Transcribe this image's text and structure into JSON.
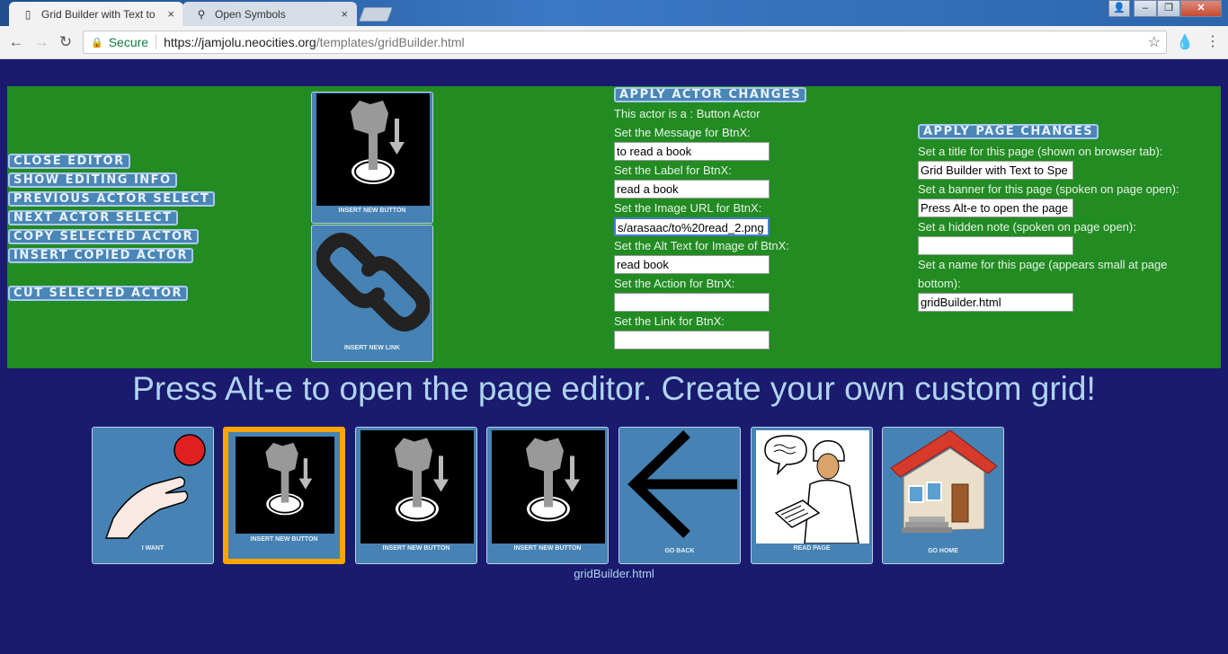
{
  "browser": {
    "tabs": [
      {
        "label": "Grid Builder with Text to",
        "close": "×"
      },
      {
        "label": "Open Symbols",
        "close": "×"
      }
    ],
    "window_controls": {
      "minimize": "–",
      "maximize": "❐",
      "close": "✕"
    },
    "security": "Secure",
    "url_host": "https://jamjolu.neocities.org",
    "url_path": "/templates/gridBuilder.html"
  },
  "editor": {
    "side_buttons": [
      "CLOSE EDITOR",
      "SHOW EDITING INFO",
      "PREVIOUS ACTOR SELECT",
      "NEXT ACTOR SELECT",
      "COPY SELECTED ACTOR",
      "INSERT COPIED ACTOR",
      "CUT SELECTED ACTOR"
    ],
    "insert_cards": [
      {
        "caption": "INSERT NEW BUTTON",
        "icon": "press-button-icon"
      },
      {
        "caption": "INSERT NEW LINK",
        "icon": "chain-link-icon"
      }
    ],
    "actor": {
      "apply_label": "APPLY ACTOR CHANGES",
      "type_line": "This actor is a : Button Actor",
      "fields": [
        {
          "label": "Set the Message for BtnX:",
          "value": "to read a book"
        },
        {
          "label": "Set the Label for BtnX:",
          "value": "read a book"
        },
        {
          "label": "Set the Image URL for BtnX:",
          "value": "s/arasaac/to%20read_2.png"
        },
        {
          "label": "Set the Alt Text for Image of BtnX:",
          "value": "read book"
        },
        {
          "label": "Set the Action for BtnX:",
          "value": ""
        },
        {
          "label": "Set the Link for BtnX:",
          "value": ""
        }
      ]
    },
    "page": {
      "apply_label": "APPLY PAGE CHANGES",
      "fields": [
        {
          "label": "Set a title for this page (shown on browser tab):",
          "value": "Grid Builder with Text to Spe"
        },
        {
          "label": "Set a banner for this page (spoken on page open):",
          "value": "Press Alt-e to open the page"
        },
        {
          "label": "Set a hidden note (spoken on page open):",
          "value": ""
        },
        {
          "label_line1": "Set a name for this page (appears small at page",
          "label_line2": "bottom):",
          "value": "gridBuilder.html"
        }
      ]
    }
  },
  "banner": "Press Alt-e to open the page editor. Create your own custom grid!",
  "grid": [
    {
      "caption": "I WANT",
      "icon": "reaching-hand-icon"
    },
    {
      "caption": "INSERT NEW BUTTON",
      "icon": "press-button-icon",
      "selected": true
    },
    {
      "caption": "INSERT NEW BUTTON",
      "icon": "press-button-icon"
    },
    {
      "caption": "INSERT NEW BUTTON",
      "icon": "press-button-icon"
    },
    {
      "caption": "GO BACK",
      "icon": "back-arrow-icon"
    },
    {
      "caption": "READ PAGE",
      "icon": "reading-person-icon"
    },
    {
      "caption": "GO HOME",
      "icon": "house-icon"
    }
  ],
  "page_name": "gridBuilder.html"
}
